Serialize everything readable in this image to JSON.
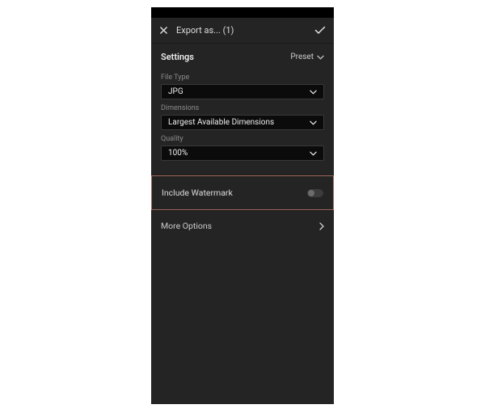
{
  "header": {
    "title": "Export as... (1)"
  },
  "settings": {
    "title": "Settings",
    "preset_label": "Preset"
  },
  "fields": {
    "file_type": {
      "label": "File Type",
      "value": "JPG"
    },
    "dimensions": {
      "label": "Dimensions",
      "value": "Largest Available Dimensions"
    },
    "quality": {
      "label": "Quality",
      "value": "100%"
    }
  },
  "watermark": {
    "label": "Include Watermark",
    "enabled": false
  },
  "more": {
    "label": "More Options"
  }
}
